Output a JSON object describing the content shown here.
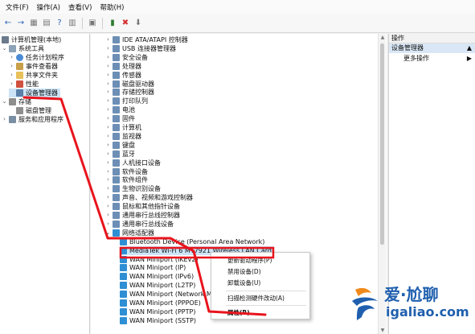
{
  "menubar": [
    "文件(F)",
    "操作(A)",
    "查看(V)",
    "帮助(H)"
  ],
  "left_tree": [
    {
      "label": "计算机管理(本地)",
      "icon": "computer-icon",
      "exp": "",
      "indent": 0
    },
    {
      "label": "系统工具",
      "icon": "tools-icon",
      "exp": "⌄",
      "indent": 1
    },
    {
      "label": "任务计划程序",
      "icon": "clock-icon",
      "exp": "›",
      "indent": 2
    },
    {
      "label": "事件查看器",
      "icon": "event-icon",
      "exp": "›",
      "indent": 2
    },
    {
      "label": "共享文件夹",
      "icon": "folder-icon",
      "exp": "›",
      "indent": 2
    },
    {
      "label": "性能",
      "icon": "performance-icon",
      "exp": "›",
      "indent": 2
    },
    {
      "label": "设备管理器",
      "icon": "device-manager-icon",
      "exp": "",
      "indent": 2
    },
    {
      "label": "存储",
      "icon": "storage-icon",
      "exp": "⌄",
      "indent": 1
    },
    {
      "label": "磁盘管理",
      "icon": "disk-icon",
      "exp": "",
      "indent": 2
    },
    {
      "label": "服务和应用程序",
      "icon": "services-icon",
      "exp": "›",
      "indent": 1
    }
  ],
  "device_categories": [
    "IDE ATA/ATAPI 控制器",
    "USB 连接器管理器",
    "安全设备",
    "处理器",
    "传感器",
    "磁盘驱动器",
    "存储控制器",
    "打印队列",
    "电池",
    "固件",
    "计算机",
    "监视器",
    "键盘",
    "蓝牙",
    "人机接口设备",
    "软件设备",
    "软件组件",
    "生物识别设备",
    "声音、视频和游戏控制器",
    "鼠标和其他指针设备",
    "通用串行总线控制器",
    "通用串行总线设备"
  ],
  "network_adapters": {
    "label": "网络适配器",
    "items": [
      "Bluetooth Device (Personal Area Network)",
      "MediaTek Wi-Fi 6 MT7921 Wireless LAN Card",
      "WAN Miniport (IKEv2)",
      "WAN Miniport (IP)",
      "WAN Miniport (IPv6)",
      "WAN Miniport (L2TP)",
      "WAN Miniport (Network Mo",
      "WAN Miniport (PPPOE)",
      "WAN Miniport (PPTP)",
      "WAN Miniport (SSTP)"
    ]
  },
  "context_menu": {
    "update_driver": "更新驱动程序(P)",
    "disable_device": "禁用设备(D)",
    "uninstall_device": "卸载设备(U)",
    "scan_hardware": "扫描检测硬件改动(A)",
    "properties": "属性(R)"
  },
  "right_pane": {
    "header": "操作",
    "section": "设备管理器",
    "more_actions": "更多操作"
  },
  "watermark": {
    "line1": "爱·尬聊",
    "line2": "igaliao.com"
  },
  "colors": {
    "annotation_red": "#e8141c",
    "selection_blue": "#cce4f7",
    "watermark_blue": "#1f5fae",
    "watermark_orange": "#f08a1c"
  }
}
